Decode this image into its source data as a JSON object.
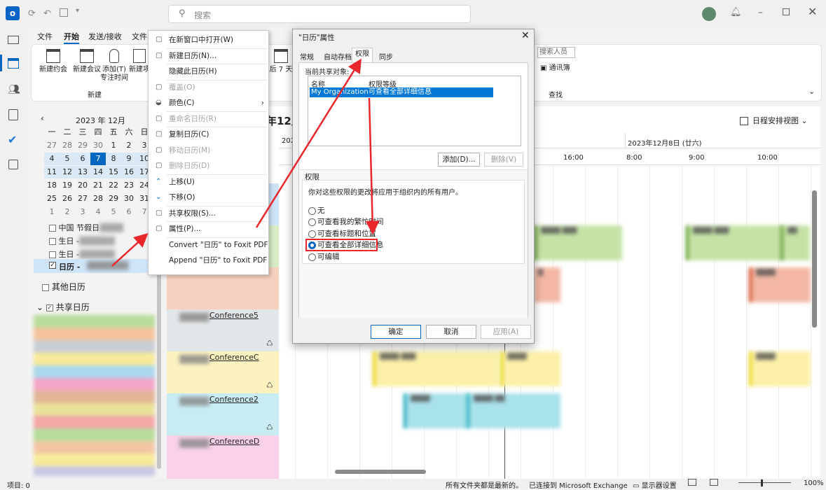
{
  "titlebar": {
    "search_placeholder": "搜索"
  },
  "menu": {
    "items": [
      "文件",
      "开始",
      "发送/接收",
      "文件"
    ]
  },
  "ribbon": {
    "new_appointment": "新建约会",
    "new_meeting": "新建会议",
    "add_focus": "添加(T)",
    "focus_time": "专注时间",
    "new_item": "新建项",
    "group_new": "新建",
    "later_7_days": "后 7 天",
    "search_people_placeholder": "搜索人员",
    "address_book": "通讯簿",
    "group_find": "查找"
  },
  "minical": {
    "month": "2023 年 12月",
    "weekdays": [
      "一",
      "二",
      "三",
      "四",
      "五",
      "六",
      "日"
    ],
    "weeks": [
      [
        "27",
        "28",
        "29",
        "30",
        "1",
        "2",
        "3"
      ],
      [
        "4",
        "5",
        "6",
        "7",
        "8",
        "9",
        "10"
      ],
      [
        "11",
        "12",
        "13",
        "14",
        "15",
        "16",
        "17"
      ],
      [
        "18",
        "19",
        "20",
        "21",
        "22",
        "23",
        "24"
      ],
      [
        "25",
        "26",
        "27",
        "28",
        "29",
        "30",
        "31"
      ],
      [
        "1",
        "2",
        "3",
        "4",
        "5",
        "6",
        "7"
      ]
    ]
  },
  "calendars": {
    "items": [
      "中国 节假日",
      "生日 -",
      "生日 -",
      "日历 -"
    ],
    "other_calendars": "其他日历",
    "shared_calendars": "共享日历"
  },
  "main": {
    "month_title": "年12月",
    "view_mode": "日程安排视图",
    "date_col_left": "202",
    "date_col_right": "2023年12月8日 (廿六)",
    "times": [
      "16:00",
      "8:00",
      "9:00",
      "10:00"
    ],
    "resources": [
      "Conference5",
      "ConferenceC",
      "Conference2",
      "ConferenceD"
    ]
  },
  "context_menu": {
    "items": [
      {
        "label": "在新窗口中打开(W)",
        "icon": "open-window-icon",
        "disabled": false
      },
      {
        "label": "新建日历(N)...",
        "icon": "new-calendar-icon",
        "disabled": false
      },
      {
        "label": "隐藏此日历(H)",
        "icon": "",
        "disabled": false
      },
      {
        "label": "覆盖(O)",
        "icon": "overlay-icon",
        "disabled": true
      },
      {
        "label": "颜色(C)",
        "icon": "color-icon",
        "disabled": false
      },
      {
        "label": "重命名日历(R)",
        "icon": "rename-icon",
        "disabled": true
      },
      {
        "label": "复制日历(C)",
        "icon": "copy-calendar-icon",
        "disabled": false
      },
      {
        "label": "移动日历(M)",
        "icon": "move-calendar-icon",
        "disabled": true
      },
      {
        "label": "删除日历(D)",
        "icon": "delete-calendar-icon",
        "disabled": true
      },
      {
        "label": "上移(U)",
        "icon": "chevron-up-icon",
        "disabled": false
      },
      {
        "label": "下移(O)",
        "icon": "chevron-down-icon",
        "disabled": false
      },
      {
        "label": "共享权限(S)...",
        "icon": "share-permissions-icon",
        "disabled": false
      },
      {
        "label": "属性(P)...",
        "icon": "properties-icon",
        "disabled": false
      },
      {
        "label": "Convert \"日历\" to Foxit PDF",
        "icon": "",
        "disabled": false
      },
      {
        "label": "Append \"日历\" to Foxit PDF",
        "icon": "",
        "disabled": false
      }
    ]
  },
  "dialog": {
    "title": "\"日历\"属性",
    "tabs": [
      "常规",
      "自动存档",
      "权限",
      "同步"
    ],
    "current_share_label": "当前共享对象:",
    "col_name": "名称",
    "col_level": "权限等级",
    "row_name": "My Organization",
    "row_level": "可查看全部详细信息",
    "add_button": "添加(D)...",
    "remove_button": "删除(V)",
    "permissions_label": "权限",
    "permissions_desc": "你对这些权限的更改将应用于组织内的所有用户。",
    "options": [
      "无",
      "可查看我的繁忙时间",
      "可查看标题和位置",
      "可查看全部详细信息",
      "可编辑"
    ],
    "ok": "确定",
    "cancel": "取消",
    "apply": "应用(A)"
  },
  "statusbar": {
    "items_count": "项目: 0",
    "all_updated": "所有文件夹都是最新的。",
    "connected": "已连接到 Microsoft Exchange",
    "display_settings": "显示器设置",
    "zoom": "100%"
  },
  "colors": {
    "accent": "#0067c0",
    "annotation_red": "#e8262b"
  }
}
